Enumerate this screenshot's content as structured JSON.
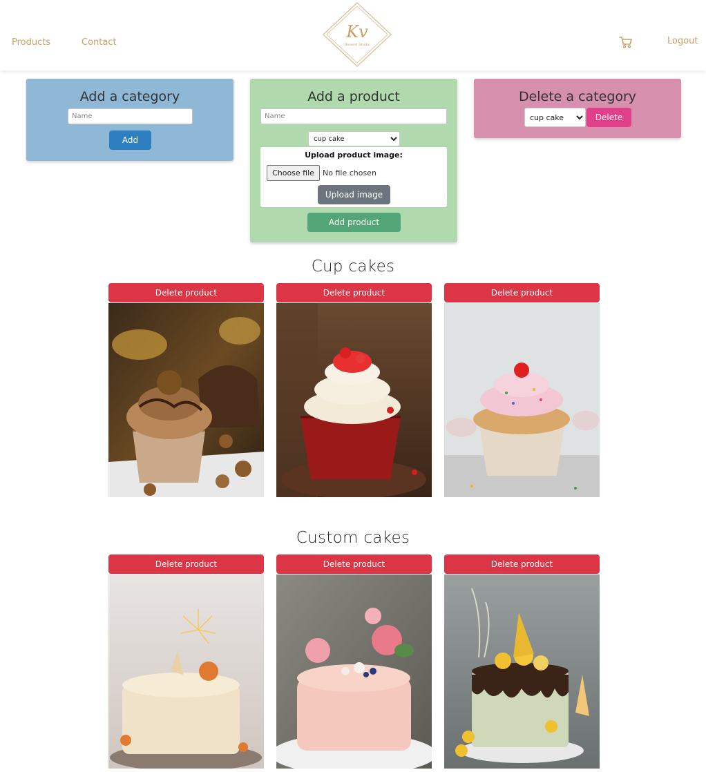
{
  "nav": {
    "products": "Products",
    "contact": "Contact",
    "logout": "Logout",
    "logo_letters": "Kv",
    "logo_subtitle": "Dessert Studio"
  },
  "add_category": {
    "title": "Add a category",
    "name_placeholder": "Name",
    "button": "Add",
    "bg": "#8fb8d6",
    "button_color": "#2d7fbf"
  },
  "add_product": {
    "title": "Add a product",
    "name_placeholder": "Name",
    "category_selected": "cup cake",
    "upload_title": "Upload product image:",
    "choose_file": "Choose file",
    "no_file": "No file chosen",
    "upload_button": "Upload image",
    "add_button": "Add product",
    "bg": "#b0d9ad",
    "button_color": "#52a677"
  },
  "delete_category": {
    "title": "Delete a category",
    "selected": "cup cake",
    "button": "Delete",
    "bg": "#d68fac",
    "button_color": "#e0408a"
  },
  "sections": [
    {
      "title": "Cup cakes",
      "products": [
        {
          "delete_label": "Delete product",
          "image": "chocolate-hazelnut-cupcake"
        },
        {
          "delete_label": "Delete product",
          "image": "red-velvet-cupcake"
        },
        {
          "delete_label": "Delete product",
          "image": "vanilla-sprinkle-cupcake"
        }
      ]
    },
    {
      "title": "Custom cakes",
      "products": [
        {
          "delete_label": "Delete product",
          "image": "sparkler-cake"
        },
        {
          "delete_label": "Delete product",
          "image": "pink-floral-cake"
        },
        {
          "delete_label": "Delete product",
          "image": "drip-macaron-cake"
        }
      ]
    }
  ],
  "colors": {
    "accent_gold": "#c9a066",
    "danger": "#dc3545",
    "secondary": "#6c757d"
  }
}
